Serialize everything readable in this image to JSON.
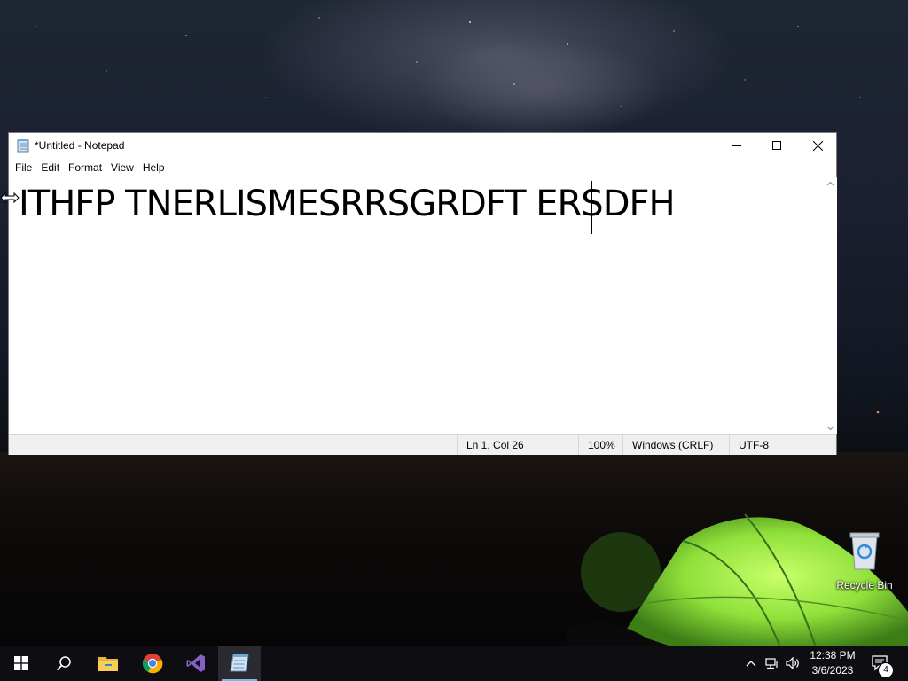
{
  "window": {
    "title": "*Untitled - Notepad",
    "menu": [
      "File",
      "Edit",
      "Format",
      "View",
      "Help"
    ],
    "content": "ITHFP TNERLISMESRRSGRDFT ERSDFH",
    "status": {
      "position": "Ln 1, Col 26",
      "zoom": "100%",
      "line_ending": "Windows (CRLF)",
      "encoding": "UTF-8"
    }
  },
  "desktop": {
    "recycle_bin_label": "Recycle Bin"
  },
  "taskbar": {
    "items": [
      "start-icon",
      "search-icon",
      "file-explorer-icon",
      "chrome-icon",
      "visual-studio-icon",
      "notepad-icon"
    ],
    "clock_time": "12:38 PM",
    "clock_date": "3/6/2023",
    "notification_count": "4"
  },
  "colors": {
    "taskbar": "#0e0e12",
    "active_underline": "#76b9ed",
    "tent_green": "#8fe03a"
  }
}
